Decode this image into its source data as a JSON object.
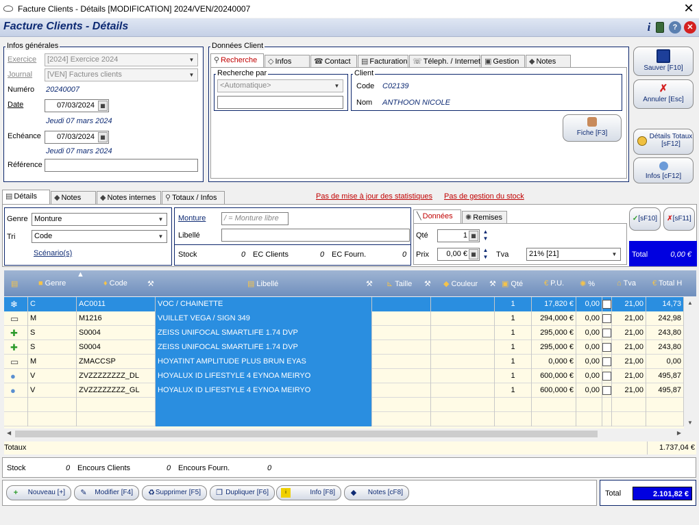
{
  "window": {
    "title": "Facture Clients - Détails [MODIFICATION] 2024/VEN/20240007",
    "close": "✕"
  },
  "header": {
    "title": "Facture Clients - Détails"
  },
  "infos_generales": {
    "legend": "Infos générales",
    "exercice_label": "Exercice",
    "exercice_value": "[2024] Exercice 2024",
    "journal_label": "Journal",
    "journal_value": "[VEN] Factures clients",
    "numero_label": "Numéro",
    "numero_value": "20240007",
    "date_label": "Date",
    "date_value": "07/03/2024",
    "date_text": "Jeudi 07 mars 2024",
    "echeance_label": "Echéance",
    "echeance_value": "07/03/2024",
    "echeance_text": "Jeudi 07 mars 2024",
    "reference_label": "Référence",
    "reference_value": ""
  },
  "donnees_client": {
    "legend": "Données Client",
    "tabs": [
      "Recherche",
      "Infos",
      "Contact",
      "Facturation",
      "Téleph. / Internet",
      "Gestion",
      "Notes"
    ],
    "recherche_par_legend": "Recherche par",
    "recherche_par_value": "<Automatique>",
    "recherche_input": "",
    "client_legend": "Client",
    "code_label": "Code",
    "code_value": "C02139",
    "nom_label": "Nom",
    "nom_value": "ANTHOON NICOLE",
    "fiche_button": "Fiche [F3]"
  },
  "right_buttons": {
    "save": "Sauver [F10]",
    "cancel": "Annuler [Esc]",
    "details_totaux": "Détails Totaux [sF12]",
    "infos": "Infos [cF12]"
  },
  "detail_tabs": [
    "Détails",
    "Notes",
    "Notes internes",
    "Totaux / Infos"
  ],
  "warnings": {
    "stats": "Pas de mise à jour des statistiques",
    "stock": "Pas de gestion du stock"
  },
  "line_form": {
    "genre_label": "Genre",
    "genre_value": "Monture",
    "tri_label": "Tri",
    "tri_value": "Code",
    "scenarios_link": "Scénario(s)",
    "monture_label": "Monture",
    "monture_placeholder": "/ = Monture libre",
    "libelle_label": "Libellé",
    "libelle_value": "",
    "stock_label": "Stock",
    "stock_value": "0",
    "ec_clients_label": "EC Clients",
    "ec_clients_value": "0",
    "ec_fourn_label": "EC Fourn.",
    "ec_fourn_value": "0",
    "sub_tabs": [
      "Données",
      "Remises"
    ],
    "qte_label": "Qté",
    "qte_value": "1",
    "prix_label": "Prix",
    "prix_value": "0,00 €",
    "tva_label": "Tva",
    "tva_value": "21% [21]",
    "ok_button": "[sF10]",
    "cancel_button": "[sF11]",
    "total_label": "Total",
    "total_value": "0,00 €"
  },
  "grid": {
    "headers": [
      "Genre",
      "Code",
      "Libellé",
      "Taille",
      "Couleur",
      "Qté",
      "P.U.",
      "%",
      "Tva",
      "Total H"
    ],
    "rows": [
      {
        "genre": "C",
        "code": "AC0011",
        "libelle": "VOC / CHAINETTE",
        "taille": "",
        "couleur": "",
        "qte": "1",
        "pu": "17,820 €",
        "pct": "0,00",
        "tva": "21,00",
        "total": "14,73"
      },
      {
        "genre": "M",
        "code": "M1216",
        "libelle": "VUILLET VEGA / SIGN 349",
        "taille": "",
        "couleur": "",
        "qte": "1",
        "pu": "294,000 €",
        "pct": "0,00",
        "tva": "21,00",
        "total": "242,98"
      },
      {
        "genre": "S",
        "code": "S0004",
        "libelle": "ZEISS UNIFOCAL SMARTLIFE 1.74 DVP",
        "taille": "",
        "couleur": "",
        "qte": "1",
        "pu": "295,000 €",
        "pct": "0,00",
        "tva": "21,00",
        "total": "243,80"
      },
      {
        "genre": "S",
        "code": "S0004",
        "libelle": "ZEISS UNIFOCAL SMARTLIFE 1.74 DVP",
        "taille": "",
        "couleur": "",
        "qte": "1",
        "pu": "295,000 €",
        "pct": "0,00",
        "tva": "21,00",
        "total": "243,80"
      },
      {
        "genre": "M",
        "code": "ZMACCSP",
        "libelle": "HOYATINT AMPLITUDE PLUS BRUN EYAS",
        "taille": "",
        "couleur": "",
        "qte": "1",
        "pu": "0,000 €",
        "pct": "0,00",
        "tva": "21,00",
        "total": "0,00"
      },
      {
        "genre": "V",
        "code": "ZVZZZZZZZZ_DL",
        "libelle": "HOYALUX ID LIFESTYLE 4 EYNOA MEIRYO",
        "taille": "",
        "couleur": "",
        "qte": "1",
        "pu": "600,000 €",
        "pct": "0,00",
        "tva": "21,00",
        "total": "495,87"
      },
      {
        "genre": "V",
        "code": "ZVZZZZZZZZ_GL",
        "libelle": "HOYALUX ID LIFESTYLE 4 EYNOA MEIRYO",
        "taille": "",
        "couleur": "",
        "qte": "1",
        "pu": "600,000 €",
        "pct": "0,00",
        "tva": "21,00",
        "total": "495,87"
      }
    ],
    "totaux_label": "Totaux",
    "totaux_value": "1.737,04 €"
  },
  "bottom_stock": {
    "stock_label": "Stock",
    "stock_value": "0",
    "ec_clients_label": "Encours Clients",
    "ec_clients_value": "0",
    "ec_fourn_label": "Encours Fourn.",
    "ec_fourn_value": "0"
  },
  "bottom_buttons": [
    "Nouveau [+]",
    "Modifier [F4]",
    "Supprimer [F5]",
    "Dupliquer [F6]",
    "Info [F8]",
    "Notes [cF8]"
  ],
  "grand_total": {
    "label": "Total",
    "value": "2.101,82 €"
  },
  "colors": {
    "accent": "#2a8ee0",
    "header_text": "#0d2a73",
    "warning": "#c00000",
    "total_bg": "#0000e0"
  }
}
